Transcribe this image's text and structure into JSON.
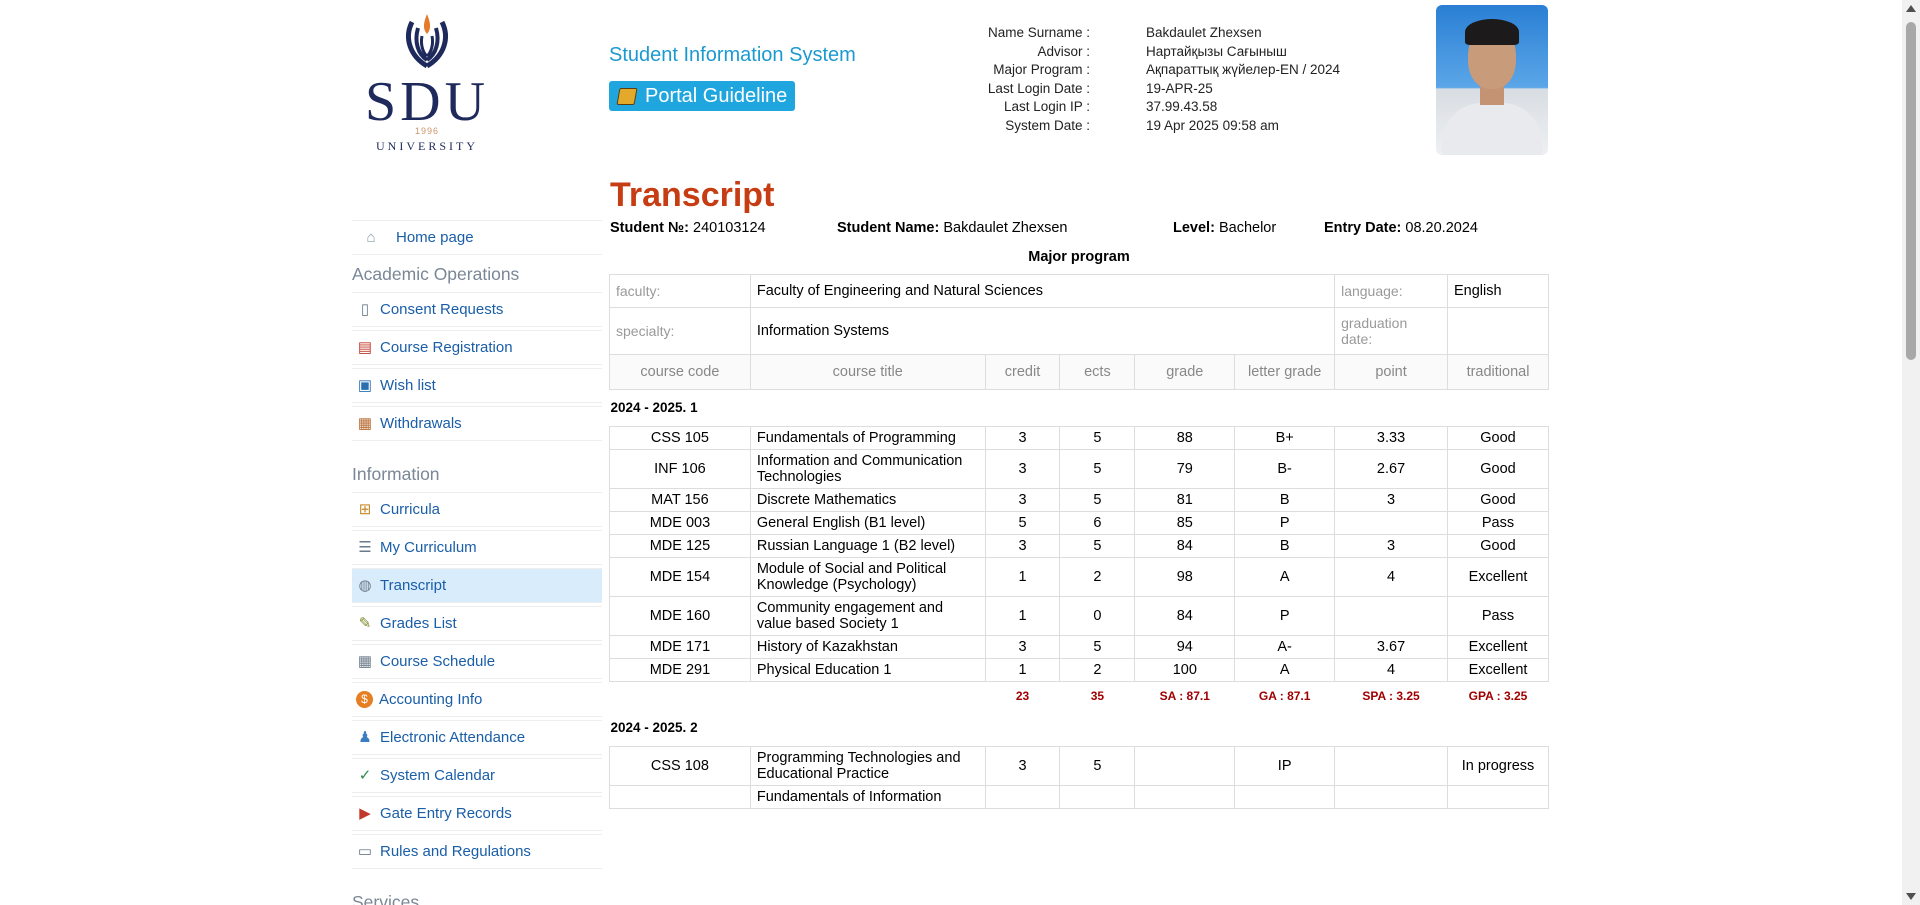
{
  "header": {
    "logo_text": "SDU",
    "logo_year": "1996",
    "logo_university": "UNIVERSITY",
    "system_title": "Student Information System",
    "guideline_label": "Portal Guideline"
  },
  "student_info": [
    {
      "label": "Name Surname :",
      "value": "Bakdaulet Zhexsen"
    },
    {
      "label": "Advisor :",
      "value": "Нартайқызы Сағыныш"
    },
    {
      "label": "Major Program :",
      "value": "Ақпараттық жүйелер-EN / 2024"
    },
    {
      "label": "Last Login Date :",
      "value": "19-APR-25"
    },
    {
      "label": "Last Login IP :",
      "value": "37.99.43.58"
    },
    {
      "label": "System Date :",
      "value": "19 Apr 2025 09:58 am"
    }
  ],
  "sidebar": {
    "home": "Home page",
    "academic_heading": "Academic Operations",
    "academic": [
      "Consent Requests",
      "Course Registration",
      "Wish list",
      "Withdrawals"
    ],
    "information_heading": "Information",
    "information": [
      "Curricula",
      "My Curriculum",
      "Transcript",
      "Grades List",
      "Course Schedule",
      "Accounting Info",
      "Electronic Attendance",
      "System Calendar",
      "Gate Entry Records",
      "Rules and Regulations"
    ],
    "services_heading": "Services",
    "active": "Transcript"
  },
  "transcript": {
    "title": "Transcript",
    "student_no_label": "Student №:",
    "student_no": "240103124",
    "student_name_label": "Student Name:",
    "student_name": "Bakdaulet Zhexsen",
    "level_label": "Level:",
    "level": "Bachelor",
    "entry_date_label": "Entry Date:",
    "entry_date": "08.20.2024",
    "major_program_heading": "Major program",
    "faculty_label": "faculty:",
    "faculty": "Faculty of Engineering and Natural Sciences",
    "language_label": "language:",
    "language": "English",
    "specialty_label": "specialty:",
    "specialty": "Information Systems",
    "graduation_label": "graduation date:",
    "graduation": "",
    "columns": [
      "course code",
      "course title",
      "credit",
      "ects",
      "grade",
      "letter grade",
      "point",
      "traditional"
    ],
    "semesters": [
      {
        "name": "2024 - 2025. 1",
        "courses": [
          [
            "CSS 105",
            "Fundamentals of Programming",
            "3",
            "5",
            "88",
            "B+",
            "3.33",
            "Good"
          ],
          [
            "INF 106",
            "Information and Communication Technologies",
            "3",
            "5",
            "79",
            "B-",
            "2.67",
            "Good"
          ],
          [
            "MAT 156",
            "Discrete Mathematics",
            "3",
            "5",
            "81",
            "B",
            "3",
            "Good"
          ],
          [
            "MDE 003",
            "General English (B1 level)",
            "5",
            "6",
            "85",
            "P",
            "",
            "Pass"
          ],
          [
            "MDE 125",
            "Russian Language 1 (B2 level)",
            "3",
            "5",
            "84",
            "B",
            "3",
            "Good"
          ],
          [
            "MDE 154",
            "Module of Social and Political Knowledge (Psychology)",
            "1",
            "2",
            "98",
            "A",
            "4",
            "Excellent"
          ],
          [
            "MDE 160",
            "Community engagement and value based Society 1",
            "1",
            "0",
            "84",
            "P",
            "",
            "Pass"
          ],
          [
            "MDE 171",
            "History of Kazakhstan",
            "3",
            "5",
            "94",
            "A-",
            "3.67",
            "Excellent"
          ],
          [
            "MDE 291",
            "Physical Education 1",
            "1",
            "2",
            "100",
            "A",
            "4",
            "Excellent"
          ]
        ],
        "totals": [
          "23",
          "35",
          "SA : 87.1",
          "GA : 87.1",
          "SPA : 3.25",
          "GPA : 3.25"
        ]
      },
      {
        "name": "2024 - 2025. 2",
        "courses": [
          [
            "CSS 108",
            "Programming Technologies and Educational Practice",
            "3",
            "5",
            "",
            "IP",
            "",
            "In progress"
          ],
          [
            "",
            "Fundamentals of Information",
            "",
            "",
            "",
            "",
            "",
            ""
          ]
        ]
      }
    ]
  }
}
